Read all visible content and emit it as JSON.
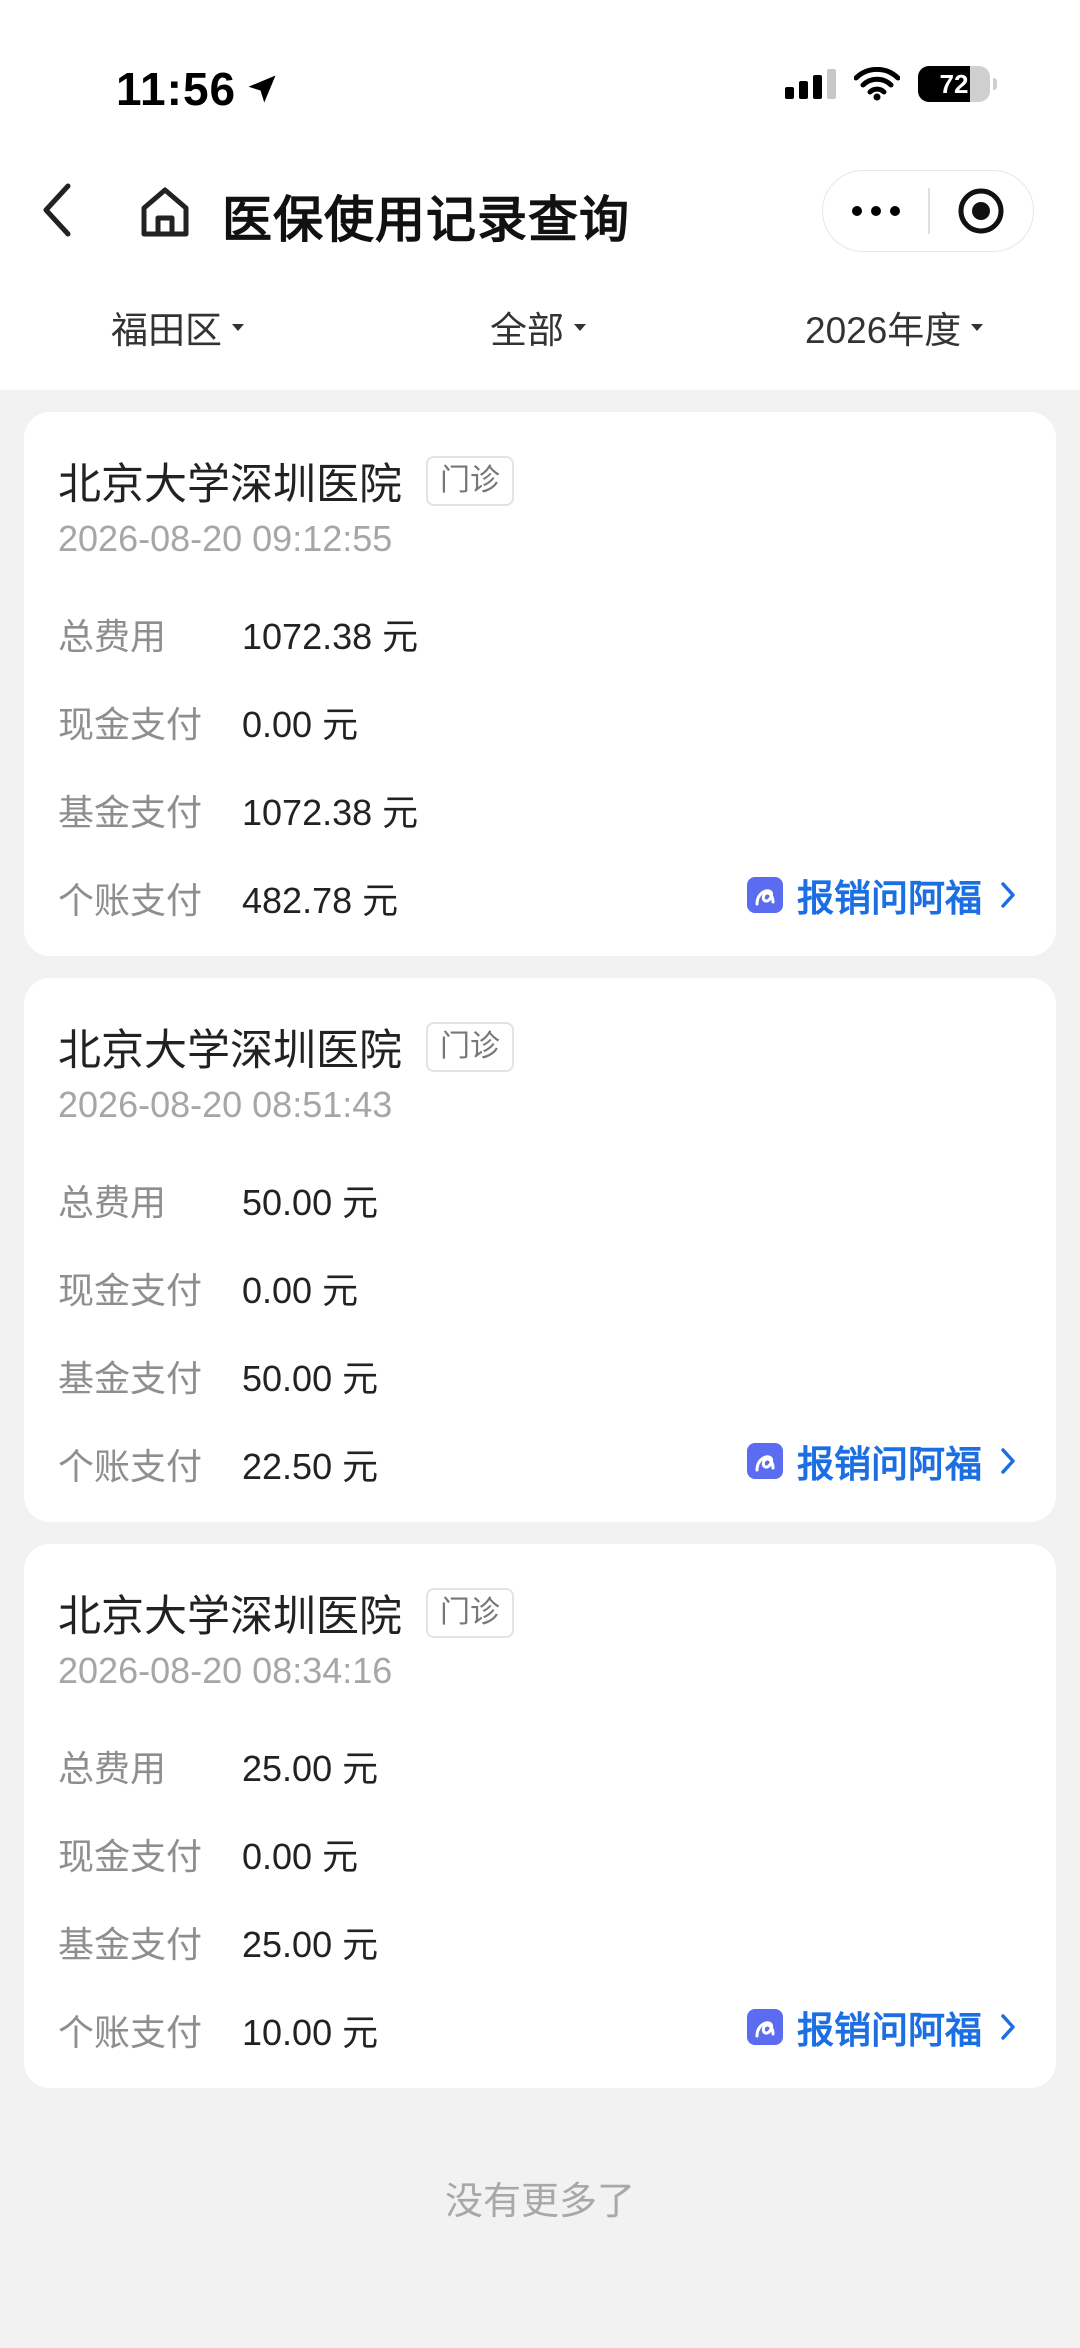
{
  "status": {
    "time": "11:56",
    "battery": "72"
  },
  "header": {
    "title": "医保使用记录查询"
  },
  "filters": [
    {
      "label": "福田区"
    },
    {
      "label": "全部"
    },
    {
      "label": "2026年度"
    }
  ],
  "labels": {
    "total": "总费用",
    "cash": "现金支付",
    "fund": "基金支付",
    "personal": "个账支付",
    "ask": "报销问阿福"
  },
  "records": [
    {
      "hospital": "北京大学深圳医院",
      "type": "门诊",
      "time": "2026-08-20 09:12:55",
      "total": "1072.38 元",
      "cash": "0.00 元",
      "fund": "1072.38 元",
      "personal": "482.78 元"
    },
    {
      "hospital": "北京大学深圳医院",
      "type": "门诊",
      "time": "2026-08-20 08:51:43",
      "total": "50.00 元",
      "cash": "0.00 元",
      "fund": "50.00 元",
      "personal": "22.50 元"
    },
    {
      "hospital": "北京大学深圳医院",
      "type": "门诊",
      "time": "2026-08-20 08:34:16",
      "total": "25.00 元",
      "cash": "0.00 元",
      "fund": "25.00 元",
      "personal": "10.00 元"
    }
  ],
  "footer": {
    "no_more": "没有更多了"
  },
  "colors": {
    "accent": "#1b6fe3",
    "icon_bg": "#5b6cf0",
    "page_bg": "#f2f2f2"
  },
  "icons": [
    "location-arrow-icon",
    "signal-icon",
    "wifi-icon",
    "battery-icon",
    "back-icon",
    "home-icon",
    "more-icon",
    "close-target-icon",
    "caret-down-icon",
    "afu-assistant-icon",
    "chevron-right-icon"
  ]
}
